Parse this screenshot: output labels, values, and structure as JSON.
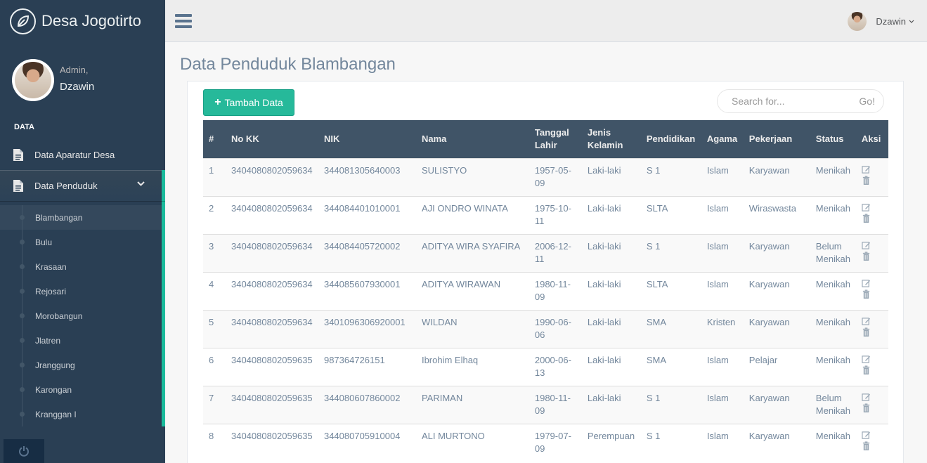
{
  "brand": {
    "title": "Desa Jogotirto"
  },
  "profile": {
    "welcome": "Admin,",
    "name": "Dzawin"
  },
  "sidebar": {
    "section_title": "DATA",
    "items": [
      {
        "label": "Data Aparatur Desa"
      },
      {
        "label": "Data Penduduk"
      }
    ],
    "subitems": [
      {
        "label": "Blambangan"
      },
      {
        "label": "Bulu"
      },
      {
        "label": "Krasaan"
      },
      {
        "label": "Rejosari"
      },
      {
        "label": "Morobangun"
      },
      {
        "label": "Jlatren"
      },
      {
        "label": "Jranggung"
      },
      {
        "label": "Karongan"
      },
      {
        "label": "Kranggan I"
      }
    ]
  },
  "topnav": {
    "user_name": "Dzawin"
  },
  "page": {
    "title": "Data Penduduk Blambangan"
  },
  "toolbar": {
    "add_label": "Tambah Data"
  },
  "search": {
    "placeholder": "Search for...",
    "go_label": "Go!"
  },
  "table": {
    "headers": [
      "#",
      "No KK",
      "NIK",
      "Nama",
      "Tanggal Lahir",
      "Jenis Kelamin",
      "Pendidikan",
      "Agama",
      "Pekerjaan",
      "Status",
      "Aksi"
    ],
    "rows": [
      [
        "1",
        "3404080802059634",
        "344081305640003",
        "SULISTYO",
        "1957-05-09",
        "Laki-laki",
        "S 1",
        "Islam",
        "Karyawan",
        "Menikah"
      ],
      [
        "2",
        "3404080802059634",
        "344084401010001",
        "AJI ONDRO WINATA",
        "1975-10-11",
        "Laki-laki",
        "SLTA",
        "Islam",
        "Wiraswasta",
        "Menikah"
      ],
      [
        "3",
        "3404080802059634",
        "344084405720002",
        "ADITYA WIRA SYAFIRA",
        "2006-12-11",
        "Laki-laki",
        "S 1",
        "Islam",
        "Karyawan",
        "Belum Menikah"
      ],
      [
        "4",
        "3404080802059634",
        "344085607930001",
        "ADITYA WIRAWAN",
        "1980-11-09",
        "Laki-laki",
        "SLTA",
        "Islam",
        "Karyawan",
        "Menikah"
      ],
      [
        "5",
        "3404080802059634",
        "3401096306920001",
        "WILDAN",
        "1990-06-06",
        "Laki-laki",
        "SMA",
        "Kristen",
        "Karyawan",
        "Menikah"
      ],
      [
        "6",
        "3404080802059635",
        "987364726151",
        "Ibrohim Elhaq",
        "2000-06-13",
        "Laki-laki",
        "SMA",
        "Islam",
        "Pelajar",
        "Menikah"
      ],
      [
        "7",
        "3404080802059635",
        "344080607860002",
        "PARIMAN",
        "1980-11-09",
        "Laki-laki",
        "S 1",
        "Islam",
        "Karyawan",
        "Belum Menikah"
      ],
      [
        "8",
        "3404080802059635",
        "344080705910004",
        "ALI MURTONO",
        "1979-07-09",
        "Perempuan",
        "S 1",
        "Islam",
        "Karyawan",
        "Menikah"
      ]
    ]
  },
  "colors": {
    "sidebar": "#2a3f54",
    "accent": "#1abb9c",
    "button": "#26b99a",
    "table_header": "#405467"
  }
}
